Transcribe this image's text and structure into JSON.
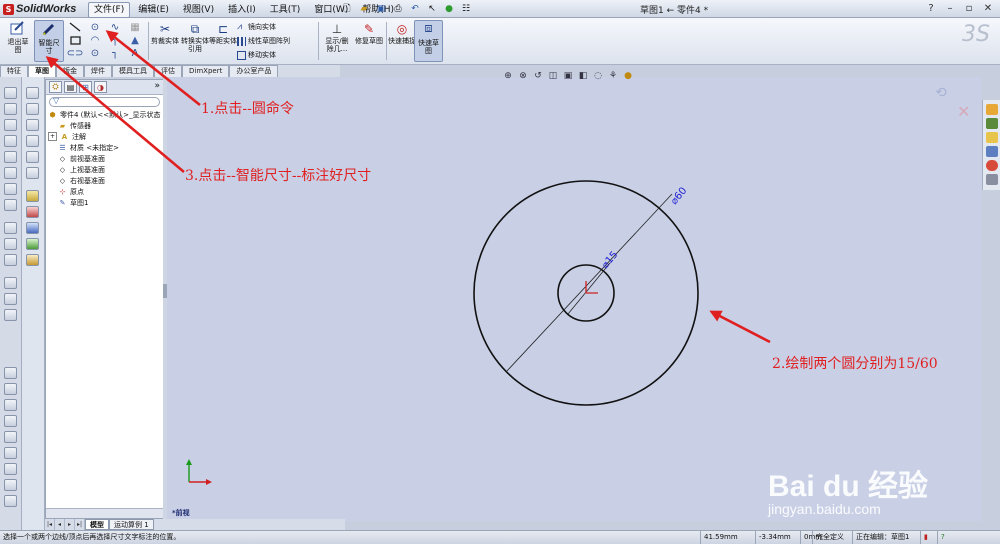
{
  "app": {
    "logo_text": "SolidWorks",
    "doc_title": "草图1 ← 零件4 *"
  },
  "menu": [
    {
      "label": "文件(F)"
    },
    {
      "label": "编辑(E)"
    },
    {
      "label": "视图(V)"
    },
    {
      "label": "插入(I)"
    },
    {
      "label": "工具(T)"
    },
    {
      "label": "窗口(W)"
    },
    {
      "label": "帮助(H)"
    }
  ],
  "window_controls": {
    "help": "?",
    "minimize": "–",
    "restore": "▫",
    "close": "✕"
  },
  "command_manager": {
    "exit_sketch": "退出草图",
    "smart_dim": "智能尺寸",
    "trim": "剪裁实体",
    "convert": "转换实体引用",
    "offset": "等距实体",
    "mirror": "镜向实体",
    "linear_pattern": "线性草图阵列",
    "move": "移动实体",
    "show_delete": "显示/删除几...",
    "repair": "修复草图",
    "quick_snap": "快速捕捉",
    "rapid_sketch": "快速草图"
  },
  "tabs": [
    {
      "label": "特征"
    },
    {
      "label": "草图"
    },
    {
      "label": "钣金"
    },
    {
      "label": "焊件"
    },
    {
      "label": "模具工具"
    },
    {
      "label": "评估"
    },
    {
      "label": "DimXpert"
    },
    {
      "label": "办公室产品"
    }
  ],
  "feature_tree": {
    "root": "零件4  (默认<<默认>_显示状态",
    "items": [
      {
        "label": "传感器"
      },
      {
        "label": "注解"
      },
      {
        "label": "材质 <未指定>"
      },
      {
        "label": "前视基准面"
      },
      {
        "label": "上视基准面"
      },
      {
        "label": "右视基准面"
      },
      {
        "label": "原点"
      },
      {
        "label": "草图1"
      }
    ]
  },
  "dimensions": {
    "small": "⌀15",
    "large": "⌀60"
  },
  "view_label": "*前视",
  "bottom_tabs": [
    {
      "label": "模型"
    },
    {
      "label": "运动算例 1"
    }
  ],
  "status": {
    "message": "选择一个或两个边线/顶点后再选择尺寸文字标注的位置。",
    "x": "41.59mm",
    "y": "-3.34mm",
    "z": "0mm",
    "defined": "完全定义",
    "editing": "正在编辑：草图1"
  },
  "annotations": {
    "step1": "1.点击--圆命令",
    "step2": "2.绘制两个圆分别为15/60",
    "step3": "3.点击--智能尺寸--标注好尺寸"
  },
  "watermark": {
    "big": "Bai du 经验",
    "small": "jingyan.baidu.com"
  },
  "colors": {
    "annotation": "#e02020",
    "dimension": "#1c1cd0",
    "graphics_bg": "#c9d0e6"
  }
}
